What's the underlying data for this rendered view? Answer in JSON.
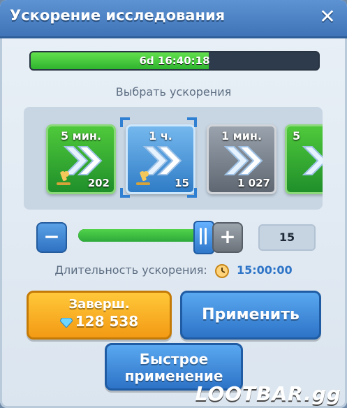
{
  "dialog": {
    "title": "Ускорение исследования",
    "close_icon": "close-icon"
  },
  "timer": {
    "text": "6d 16:40:18",
    "progress": 0.62
  },
  "boosts": {
    "section_title": "Выбрать ускорения",
    "items": [
      {
        "label": "5 мин.",
        "count": "202",
        "style": "green",
        "icon": "microscope-icon"
      },
      {
        "label": "1 ч.",
        "count": "15",
        "style": "blue",
        "icon": "microscope-icon",
        "selected": true
      },
      {
        "label": "1 мин.",
        "count": "1 027",
        "style": "gray",
        "icon": "fast-forward-icon"
      },
      {
        "label": "5",
        "count": "",
        "style": "green",
        "icon": "fast-forward-icon"
      }
    ]
  },
  "slider": {
    "fill_fraction": 1.0,
    "quantity": "15"
  },
  "duration": {
    "label": "Длительность ускорения:",
    "value": "15:00:00"
  },
  "buttons": {
    "finish_line1": "Заверш.",
    "finish_amount": "128 538",
    "apply": "Применить",
    "quick_line1": "Быстрое",
    "quick_line2": "применение"
  },
  "watermark": "LOOTBAR.gg"
}
